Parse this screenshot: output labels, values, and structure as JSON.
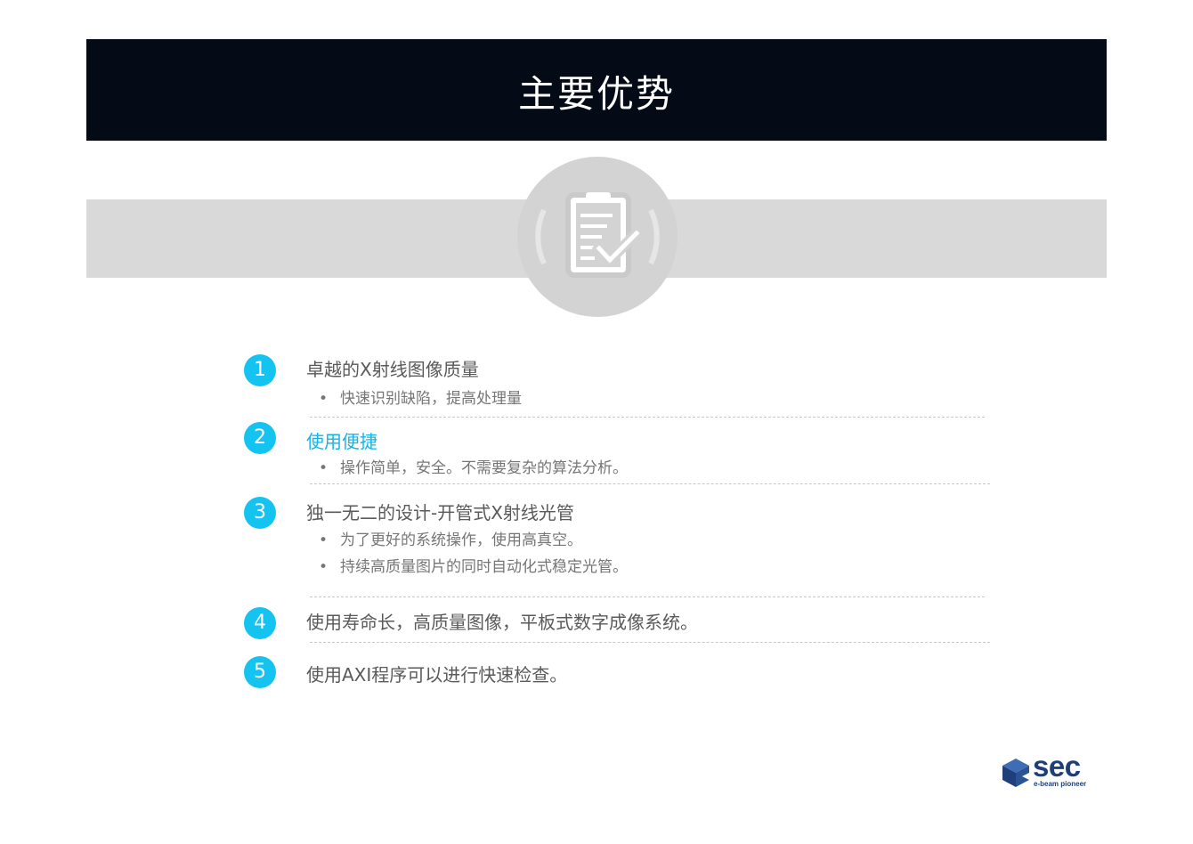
{
  "header": {
    "title": "主要优势"
  },
  "icons": {
    "center": "clipboard-check-icon",
    "logo": "sec-cube-logo"
  },
  "colors": {
    "header_bg": "#040a16",
    "accent": "#14c3ef",
    "band": "#d9d9d9",
    "logo": "#1e3f7a"
  },
  "items": [
    {
      "number": "1",
      "title": "卓越的X射线图像质量",
      "bullets": [
        "快速识别缺陷，提高处理量"
      ]
    },
    {
      "number": "2",
      "title": "使用便捷",
      "bullets": [
        "操作简单，安全。不需要复杂的算法分析。"
      ]
    },
    {
      "number": "3",
      "title": "独一无二的设计-开管式X射线光管",
      "bullets": [
        "为了更好的系统操作，使用高真空。",
        "持续高质量图片的同时自动化式稳定光管。"
      ]
    },
    {
      "number": "4",
      "title": "使用寿命长，高质量图像，平板式数字成像系统。",
      "bullets": []
    },
    {
      "number": "5",
      "title": "使用AXI程序可以进行快速检查。",
      "bullets": []
    }
  ],
  "bullet_symbol": "•",
  "logo": {
    "word": "sec",
    "tagline": "e-beam pioneer"
  }
}
